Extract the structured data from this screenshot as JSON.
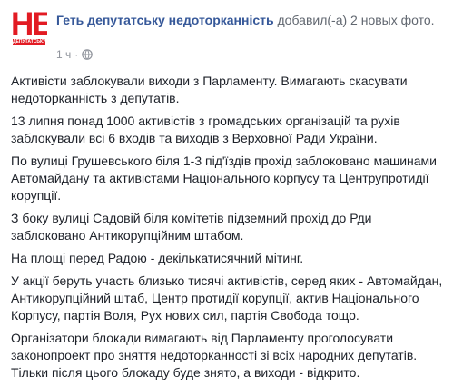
{
  "avatar": {
    "logo_text": "НЕ",
    "logo_subtext": "ДЕПУТАТСЬКУ"
  },
  "header": {
    "page_name": "Геть депутатську недоторканність",
    "added_text": "добавил(-а)",
    "photos_text": "2 новых фото."
  },
  "meta": {
    "timestamp": "1 ч",
    "separator": "·",
    "privacy_icon": "globe-icon"
  },
  "post": {
    "paragraphs": [
      "Активісти заблокували виходи з Парламенту. Вимагають скасувати недоторканність з депутатів.",
      "13 липня понад 1000 активістів з громадських організацій та рухів заблокували всі 6 входів та виходів з Верховної Ради України.",
      "По вулиці Грушевського біля 1-3 під'їздів прохід заблоковано машинами Автомайдану та активістами Національного корпусу та Центрупротидії корупції.",
      "З боку вулиці Садовій біля комітетів підземний прохід до Рди заблоковано Антикорупційним штабом.",
      "На площі перед Радою - декількатисячний мітинг.",
      "У акції беруть участь близько тисячі активістів, серед яких - Автомайдан, Антикорупційний штаб, Центр протидії корупції, актив Національного Корпусу, партія Воля, Рух нових сил, партія Свобода тощо.",
      "Організатори блокади вимагають від Парламенту проголосувати законопроект про зняття недоторканності зі всіх народних депутатів. Тільки після цього блокаду буде знято, а виходи - відкрито."
    ]
  },
  "colors": {
    "link": "#365899",
    "secondary": "#616770",
    "meta": "#90949c",
    "text": "#1d2129",
    "logo_red": "#e21b23"
  }
}
